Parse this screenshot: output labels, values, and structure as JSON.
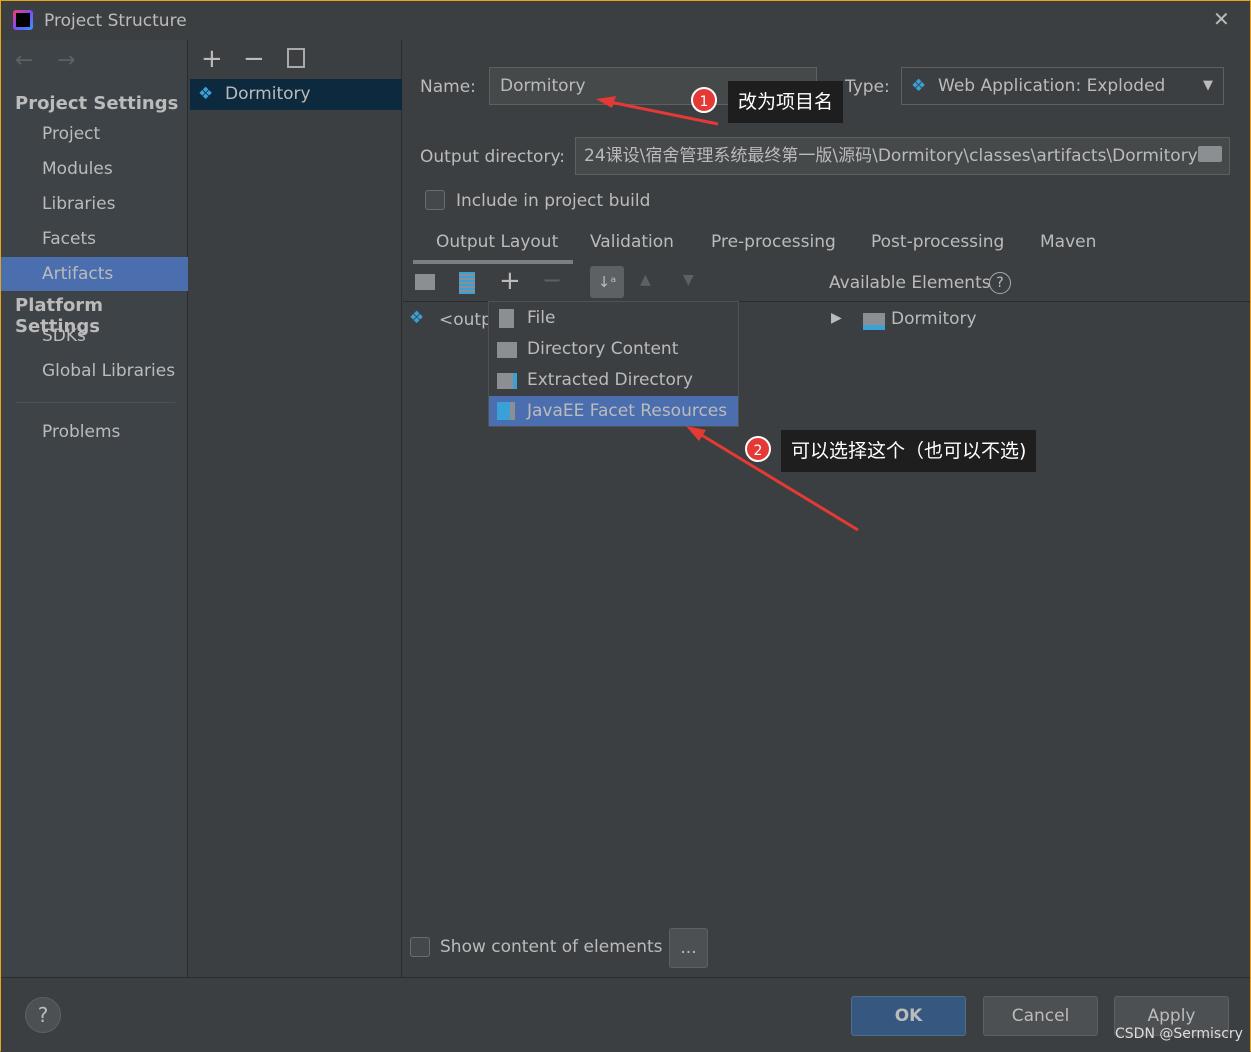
{
  "window": {
    "title": "Project Structure"
  },
  "sidebar": {
    "project_settings": "Project Settings",
    "items": [
      "Project",
      "Modules",
      "Libraries",
      "Facets",
      "Artifacts"
    ],
    "platform_settings": "Platform Settings",
    "platform_items": [
      "SDKs",
      "Global Libraries"
    ],
    "problems": "Problems",
    "selected": "Artifacts"
  },
  "artifacts": {
    "items": [
      "Dormitory"
    ]
  },
  "form": {
    "name_label": "Name:",
    "name_value": "Dormitory",
    "type_label": "Type:",
    "type_value": "Web Application: Exploded",
    "output_label": "Output directory:",
    "output_value": "24课设\\宿舍管理系统最终第一版\\源码\\Dormitory\\classes\\artifacts\\Dormitory",
    "include_label": "Include in project build",
    "include_checked": false
  },
  "tabs": [
    "Output Layout",
    "Validation",
    "Pre-processing",
    "Post-processing",
    "Maven"
  ],
  "active_tab": "Output Layout",
  "tree": {
    "root": "<outp"
  },
  "add_menu": {
    "items": [
      "File",
      "Directory Content",
      "Extracted Directory",
      "JavaEE Facet Resources"
    ],
    "highlighted": "JavaEE Facet Resources"
  },
  "available": {
    "label": "Available Elements",
    "items": [
      "Dormitory"
    ]
  },
  "show_content": {
    "label": "Show content of elements",
    "button": "...",
    "checked": false
  },
  "annotations": [
    {
      "num": "1",
      "text": "改为项目名"
    },
    {
      "num": "2",
      "text": "可以选择这个（也可以不选)"
    }
  ],
  "footer": {
    "ok": "OK",
    "cancel": "Cancel",
    "apply": "Apply",
    "help": "?"
  },
  "watermark": "CSDN @Sermiscry",
  "colors": {
    "selection": "#4b6eaf",
    "tree_selection": "#0d293e",
    "accent_border": "#e8a317",
    "annotation_red": "#e53935"
  }
}
